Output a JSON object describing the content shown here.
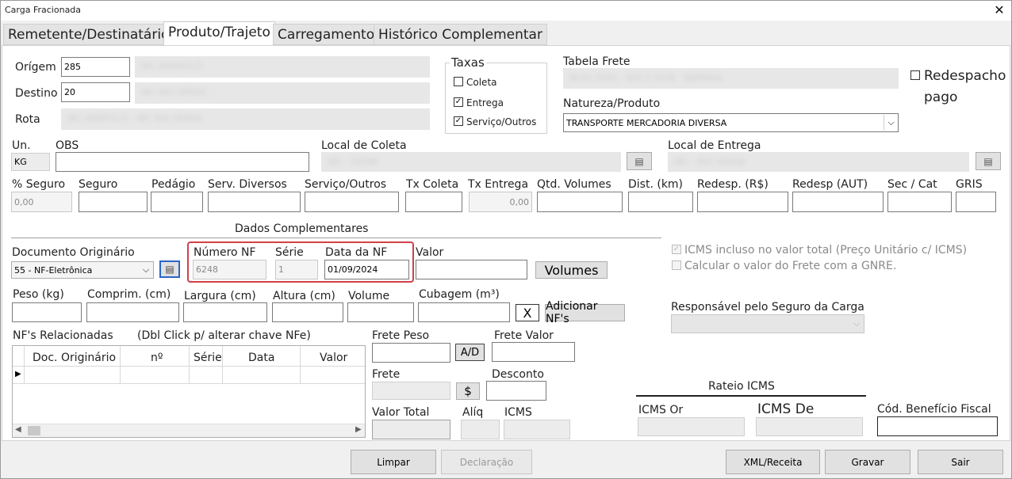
{
  "window": {
    "title": "Carga Fracionada"
  },
  "tabs": [
    "Remetente/Destinatário",
    "Produto/Trajeto",
    "Carregamento",
    "Histórico Complementar"
  ],
  "trajeto": {
    "origem_label": "Orígem",
    "origem_value": "285",
    "destino_label": "Destino",
    "destino_value": "20",
    "rota_label": "Rota"
  },
  "taxas": {
    "title": "Taxas",
    "coleta": "Coleta",
    "coleta_checked": false,
    "entrega": "Entrega",
    "entrega_checked": true,
    "servico": "Serviço/Outros",
    "servico_checked": true
  },
  "tabela_frete_label": "Tabela Frete",
  "natureza": {
    "label": "Natureza/Produto",
    "value": "TRANSPORTE MERCADORIA DIVERSA"
  },
  "redespacho": {
    "label_1": "Redespacho",
    "label_2": "pago",
    "checked": false
  },
  "un": {
    "label": "Un.",
    "value": "KG"
  },
  "obs_label": "OBS",
  "local_coleta_label": "Local de Coleta",
  "local_entrega_label": "Local de Entrega",
  "fees": {
    "pct_seguro": "% Seguro",
    "pct_seguro_value": "0,00",
    "seguro": "Seguro",
    "pedagio": "Pedágio",
    "serv_diversos": "Serv. Diversos",
    "servico_outros": "Serviço/Outros",
    "tx_coleta": "Tx Coleta",
    "tx_entrega": "Tx Entrega",
    "tx_entrega_value": "0,00",
    "qtd_volumes": "Qtd. Volumes",
    "dist_km": "Dist. (km)",
    "redesp_rs": "Redesp. (R$)",
    "redesp_aut": "Redesp (AUT)",
    "sec_cat": "Sec / Cat",
    "gris": "GRIS"
  },
  "dados_complementares": "Dados Complementares",
  "documento": {
    "label": "Documento Originário",
    "value": "55 - NF-Eletrônica"
  },
  "nf": {
    "numero_label": "Número NF",
    "numero_value": "6248",
    "serie_label": "Série",
    "serie_value": "1",
    "data_label": "Data da NF",
    "data_value": "01/09/2024",
    "valor_label": "Valor",
    "volumes_button": "Volumes"
  },
  "medidas": {
    "peso": "Peso (kg)",
    "comprim": "Comprim. (cm)",
    "largura": "Largura (cm)",
    "altura": "Altura (cm)",
    "volume": "Volume",
    "cubagem": "Cubagem (m³)",
    "clear_button": "X",
    "adicionar_button": "Adicionar NF's"
  },
  "icms_opts": {
    "incluso": "ICMS incluso no valor total (Preço Unitário c/ ICMS)",
    "incluso_checked": true,
    "gnre": "Calcular o valor do Frete com a GNRE.",
    "gnre_checked": false
  },
  "responsavel_label": "Responsável pelo Seguro da Carga",
  "nfs": {
    "title": "NF's Relacionadas",
    "hint": "(Dbl Click p/ alterar chave NFe)",
    "columns": [
      "Doc. Originário",
      "nº",
      "Série",
      "Data",
      "Valor"
    ]
  },
  "frete": {
    "peso_label": "Frete Peso",
    "ad_button": "A/D",
    "valor_label": "Frete Valor",
    "frete_label": "Frete",
    "dollar_button": "$",
    "desconto_label": "Desconto",
    "valor_total_label": "Valor Total",
    "aliq_label": "Alíq",
    "icms_label": "ICMS"
  },
  "rateio": {
    "title": "Rateio ICMS",
    "icms_or": "ICMS Or",
    "icms_de": "ICMS De",
    "cod_beneficio": "Cód. Benefício Fiscal"
  },
  "footer": {
    "limpar": "Limpar",
    "declaracao": "Declaração",
    "xml": "XML/Receita",
    "gravar": "Gravar",
    "sair": "Sair"
  },
  "colors": {
    "highlight": "#d0404a",
    "window_bg": "#f0f0f0"
  }
}
